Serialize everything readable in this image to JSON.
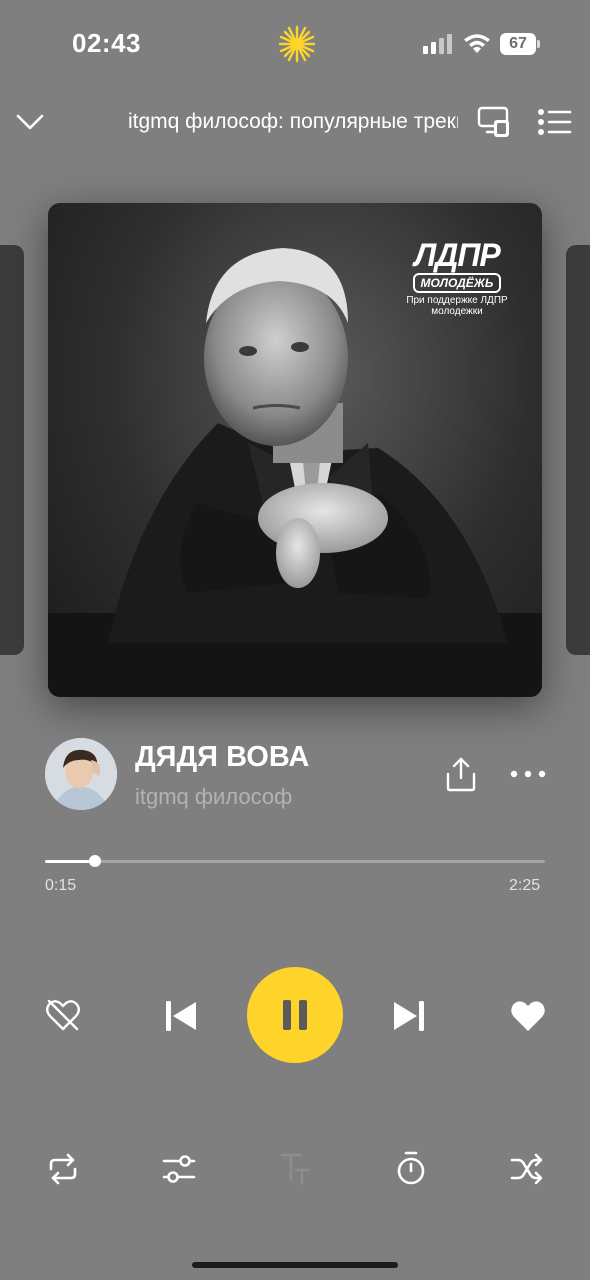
{
  "status_bar": {
    "time": "02:43",
    "battery": "67",
    "icons": [
      "sun-icon",
      "signal-icon",
      "wifi-icon",
      "battery-icon"
    ]
  },
  "header": {
    "playlist_title": "itgmq философ: популярные треки",
    "icons": [
      "chevron-down-icon",
      "device-icon",
      "queue-icon"
    ]
  },
  "cover": {
    "logo_main": "ЛДПР",
    "logo_sub": "МОЛОДЁЖЬ",
    "caption": "При поддержке ЛДПР молодежки"
  },
  "track": {
    "title": "ДЯДЯ ВОВА",
    "artist": "itgmq философ"
  },
  "progress": {
    "elapsed": "0:15",
    "total": "2:25",
    "fraction": 0.1
  },
  "controls": {
    "icons": [
      "dislike-icon",
      "previous-icon",
      "pause-icon",
      "next-icon",
      "heart-icon"
    ]
  },
  "bottom_bar": {
    "icons": [
      "repeat-icon",
      "equalizer-icon",
      "lyrics-icon",
      "timer-icon",
      "shuffle-icon"
    ]
  },
  "colors": {
    "background": "#7f7f7f",
    "accent": "#fed42b",
    "text_primary": "#ffffff",
    "text_secondary": "#b3b3b3"
  }
}
